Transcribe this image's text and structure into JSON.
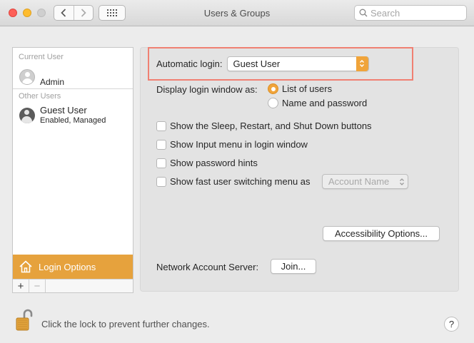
{
  "window": {
    "title": "Users & Groups",
    "search_placeholder": "Search"
  },
  "sidebar": {
    "current_user_label": "Current User",
    "current_user": {
      "name": "Admin"
    },
    "other_users_label": "Other Users",
    "other_users": [
      {
        "name": "Guest User",
        "status": "Enabled, Managed"
      }
    ],
    "login_options_label": "Login Options",
    "add_label": "+",
    "remove_label": "−"
  },
  "login": {
    "automatic_login_label": "Automatic login:",
    "automatic_login_value": "Guest User",
    "display_window_label": "Display login window as:",
    "display_options": [
      {
        "label": "List of users",
        "selected": true
      },
      {
        "label": "Name and password",
        "selected": false
      }
    ],
    "checkboxes": [
      {
        "label": "Show the Sleep, Restart, and Shut Down buttons",
        "checked": false
      },
      {
        "label": "Show Input menu in login window",
        "checked": false
      },
      {
        "label": "Show password hints",
        "checked": false
      },
      {
        "label": "Show fast user switching menu as",
        "checked": false
      }
    ],
    "fast_switching_value": "Account Name",
    "accessibility_button": "Accessibility Options...",
    "network_server_label": "Network Account Server:",
    "join_button": "Join..."
  },
  "footer": {
    "lock_text": "Click the lock to prevent further changes.",
    "help_label": "?"
  },
  "colors": {
    "accent": "#e6a23d",
    "highlight_border": "#f08072"
  }
}
